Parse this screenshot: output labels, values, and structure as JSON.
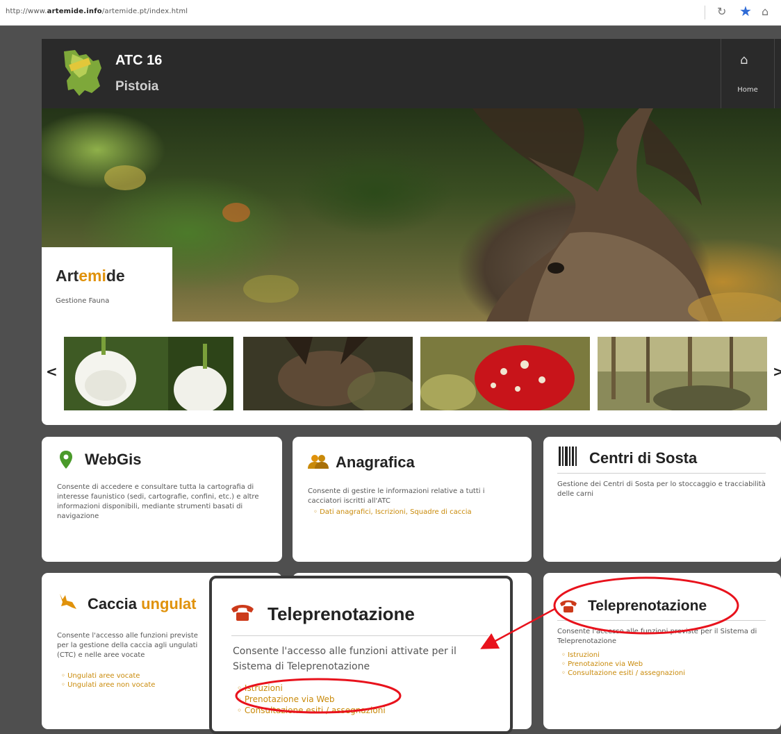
{
  "browser": {
    "url_prefix": "http://www.",
    "url_domain": "artemide.info",
    "url_path": "/artemide.pt/index.html"
  },
  "header": {
    "brand_line1": "ATC 16",
    "brand_line2": "Pistoia",
    "nav_home": "Home"
  },
  "hero": {
    "title_a": "Art",
    "title_b": "emi",
    "title_c": "de",
    "subtitle": "Gestione Fauna"
  },
  "carousel": {
    "prev": "<",
    "next": ">",
    "thumbs": [
      "flowers",
      "deer",
      "mushroom",
      "forest"
    ]
  },
  "cards": {
    "webgis": {
      "title": "WebGis",
      "desc": "Consente di accedere e consultare tutta la cartografia di interesse faunistico (sedi, cartografie, confini, etc.) e altre informazioni disponibili, mediante strumenti basati di navigazione"
    },
    "anagrafica": {
      "title": "Anagrafica",
      "desc": "Consente di gestire le informazioni relative a tutti i cacciatori iscritti all'ATC",
      "items": [
        "Dati anagrafici, Iscrizioni, Squadre di caccia"
      ]
    },
    "centri": {
      "title": "Centri di Sosta",
      "desc": "Gestione dei Centri di Sosta per lo stoccaggio e tracciabilità delle carni"
    },
    "caccia": {
      "title_a": "Caccia ",
      "title_b": "ungulat",
      "desc": "Consente l'accesso alle funzioni previste per la gestione della caccia agli ungulati (CTC) e nelle aree vocate",
      "items": [
        "Ungulati aree vocate",
        "Ungulati aree non vocate"
      ]
    },
    "tele_small": {
      "title": "Teleprenotazione",
      "desc": "Consente l'accesso alle funzioni previste per il Sistema di Teleprenotazione",
      "items": [
        "Istruzioni",
        "Prenotazione via Web",
        "Consultazione esiti / assegnazioni"
      ]
    }
  },
  "popup": {
    "title": "Teleprenotazione",
    "desc": "Consente l'accesso alle funzioni attivate per il Sistema di Teleprenotazione",
    "items": [
      "Istruzioni",
      "Prenotazione via Web",
      "Consultazione esiti / assegnazioni"
    ]
  },
  "colors": {
    "accent": "#e0920b",
    "link": "#c98a0a",
    "annotation": "#e8121c",
    "topbar": "#2a2a2a"
  }
}
